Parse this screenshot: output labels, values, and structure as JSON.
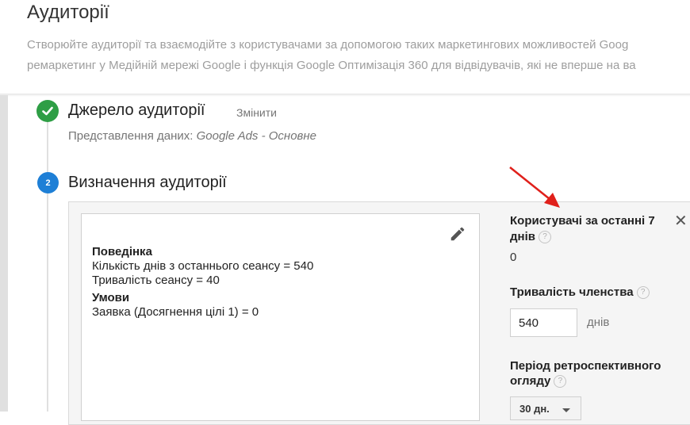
{
  "page": {
    "title": "Аудиторії",
    "description_line1": "Створюйте аудиторії та взаємодійте з користувачами за допомогою таких маркетингових можливостей Goog",
    "description_line2": "ремаркетинг у Медійній мережі Google і функція Google Оптимізація 360 для відвідувачів, які не вперше на ва"
  },
  "step1": {
    "title": "Джерело аудиторії",
    "change_link": "Змінити",
    "subtitle_label": "Представлення даних: ",
    "subtitle_value": "Google Ads - Основне"
  },
  "step2": {
    "number": "2",
    "title": "Визначення аудиторії"
  },
  "summary": {
    "behavior_heading": "Поведінка",
    "behavior_line1": "Кількість днів з останнього сеансу = 540",
    "behavior_line2": "Тривалість сеансу = 40",
    "conditions_heading": "Умови",
    "conditions_line1": "Заявка (Досягнення цілі 1) = 0"
  },
  "side": {
    "users_label": "Користувачі за останні 7 днів",
    "users_value": "0",
    "duration_label": "Тривалість членства",
    "duration_value": "540",
    "duration_unit": "днів",
    "lookback_label": "Період ретроспективного огляду",
    "lookback_value": "30 дн.",
    "help_glyph": "?",
    "close_glyph": "✕"
  },
  "colors": {
    "check_green": "#2e9e45",
    "step_blue": "#1e7fd6",
    "annotation_arrow": "#e0201b"
  },
  "icons": {
    "check": "check-icon",
    "pencil": "pencil-icon",
    "close": "close-icon",
    "help": "help-icon",
    "dropdown": "caret-down-icon"
  }
}
